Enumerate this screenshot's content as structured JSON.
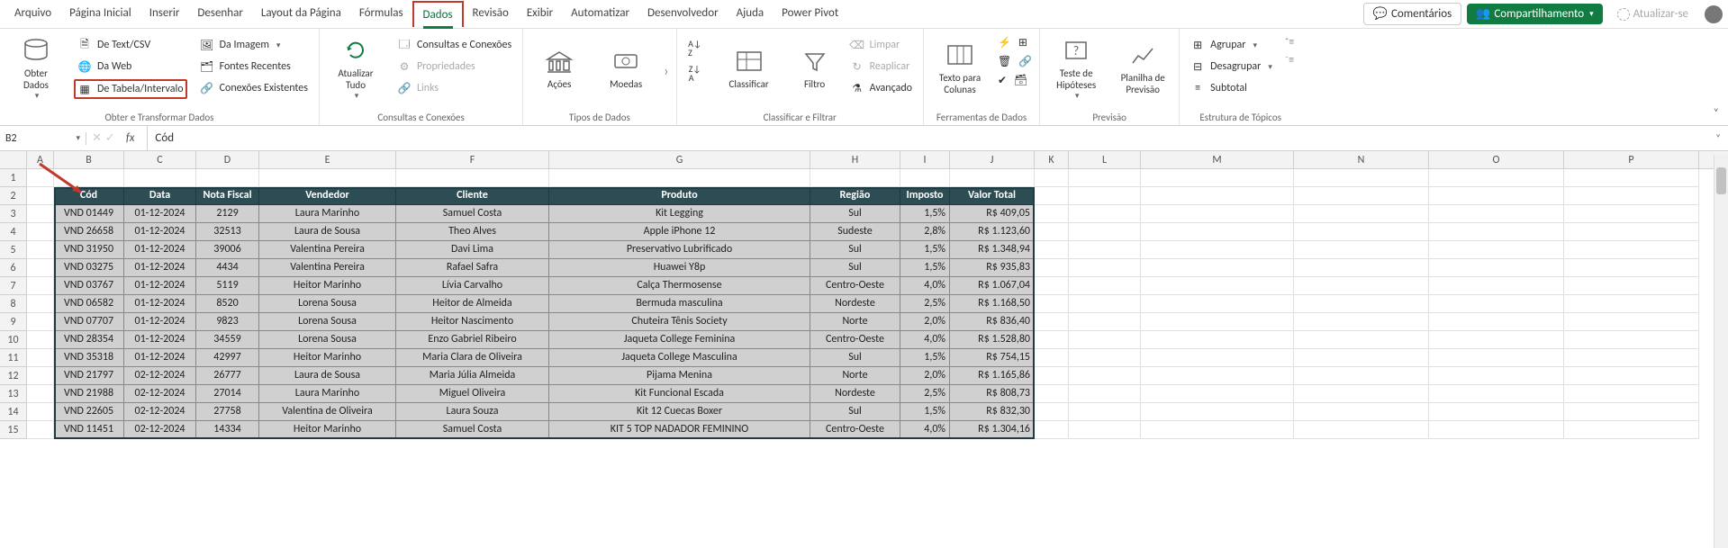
{
  "menu": {
    "items": [
      "Arquivo",
      "Página Inicial",
      "Inserir",
      "Desenhar",
      "Layout da Página",
      "Fórmulas",
      "Dados",
      "Revisão",
      "Exibir",
      "Automatizar",
      "Desenvolvedor",
      "Ajuda",
      "Power Pivot"
    ],
    "active_index": 6,
    "comments": "Comentários",
    "share": "Compartilhamento",
    "update": "Atualizar-se"
  },
  "ribbon": {
    "getdata": {
      "big": "Obter\nDados",
      "items": [
        "De Text/CSV",
        "Da Web",
        "De Tabela/Intervalo",
        "Da Imagem",
        "Fontes Recentes",
        "Conexões Existentes"
      ],
      "group": "Obter e Transformar Dados"
    },
    "queries": {
      "big": "Atualizar\nTudo",
      "items": [
        "Consultas e Conexões",
        "Propriedades",
        "Links"
      ],
      "group": "Consultas e Conexões"
    },
    "types": {
      "items": [
        "Ações",
        "Moedas"
      ],
      "group": "Tipos de Dados"
    },
    "sort": {
      "label": "Classificar",
      "group": "Classificar e Filtrar",
      "filter": "Filtro",
      "clear": "Limpar",
      "reapply": "Reaplicar",
      "advanced": "Avançado"
    },
    "tools": {
      "items": [
        "Texto para\nColunas"
      ],
      "group": "Ferramentas de Dados"
    },
    "forecast": {
      "items": [
        "Teste de\nHipóteses",
        "Planilha de\nPrevisão"
      ],
      "group": "Previsão"
    },
    "outline": {
      "items": [
        "Agrupar",
        "Desagrupar",
        "Subtotal"
      ],
      "group": "Estrutura de Tópicos"
    }
  },
  "formula": {
    "namebox": "B2",
    "fx": "fx",
    "value": "Cód"
  },
  "columns": {
    "letters": [
      "A",
      "B",
      "C",
      "D",
      "E",
      "F",
      "G",
      "H",
      "I",
      "J",
      "K",
      "L",
      "M",
      "N",
      "O",
      "P"
    ]
  },
  "headers": [
    "Cód",
    "Data",
    "Nota Fiscal",
    "Vendedor",
    "Cliente",
    "Produto",
    "Região",
    "Imposto",
    "Valor Total"
  ],
  "rows": [
    [
      "VND 01449",
      "01-12-2024",
      "2129",
      "Laura Marinho",
      "Samuel Costa",
      "Kit Legging",
      "Sul",
      "1,5%",
      "R$     409,05"
    ],
    [
      "VND 26658",
      "01-12-2024",
      "32513",
      "Laura de Sousa",
      "Theo Alves",
      "Apple iPhone 12",
      "Sudeste",
      "2,8%",
      "R$  1.123,60"
    ],
    [
      "VND 31950",
      "01-12-2024",
      "39006",
      "Valentina Pereira",
      "Davi Lima",
      "Preservativo Lubrificado",
      "Sul",
      "1,5%",
      "R$  1.348,94"
    ],
    [
      "VND 03275",
      "01-12-2024",
      "4434",
      "Valentina Pereira",
      "Rafael Safra",
      "Huawei Y8p",
      "Sul",
      "1,5%",
      "R$     935,83"
    ],
    [
      "VND 03767",
      "01-12-2024",
      "5119",
      "Heitor Marinho",
      "Lívia Carvalho",
      "Calça Thermosense",
      "Centro-Oeste",
      "4,0%",
      "R$  1.067,04"
    ],
    [
      "VND 06582",
      "01-12-2024",
      "8520",
      "Lorena Sousa",
      "Heitor de Almeida",
      "Bermuda masculina",
      "Nordeste",
      "2,5%",
      "R$  1.168,50"
    ],
    [
      "VND 07707",
      "01-12-2024",
      "9823",
      "Lorena Sousa",
      "Heitor Nascimento",
      "Chuteira Tênis Society",
      "Norte",
      "2,0%",
      "R$     836,40"
    ],
    [
      "VND 28354",
      "01-12-2024",
      "34559",
      "Lorena Sousa",
      "Enzo Gabriel Ribeiro",
      "Jaqueta College Feminina",
      "Centro-Oeste",
      "4,0%",
      "R$  1.528,80"
    ],
    [
      "VND 35318",
      "01-12-2024",
      "42997",
      "Heitor Marinho",
      "Maria Clara de Oliveira",
      "Jaqueta College Masculina",
      "Sul",
      "1,5%",
      "R$     754,15"
    ],
    [
      "VND 21797",
      "02-12-2024",
      "26777",
      "Laura de Sousa",
      "Maria Júlia Almeida",
      "Pijama Menina",
      "Norte",
      "2,0%",
      "R$  1.165,86"
    ],
    [
      "VND 21988",
      "02-12-2024",
      "27014",
      "Laura Marinho",
      "Miguel Oliveira",
      "Kit Funcional Escada",
      "Nordeste",
      "2,5%",
      "R$     808,73"
    ],
    [
      "VND 22605",
      "02-12-2024",
      "27758",
      "Valentina de Oliveira",
      "Laura Souza",
      "Kit 12 Cuecas Boxer",
      "Sul",
      "1,5%",
      "R$     832,30"
    ],
    [
      "VND 11451",
      "02-12-2024",
      "14334",
      "Heitor Marinho",
      "Samuel Costa",
      "KIT 5 TOP NADADOR FEMININO",
      "Centro-Oeste",
      "4,0%",
      "R$  1.304,16"
    ]
  ],
  "chart_data": {
    "type": "table",
    "columns": [
      "Cód",
      "Data",
      "Nota Fiscal",
      "Vendedor",
      "Cliente",
      "Produto",
      "Região",
      "Imposto",
      "Valor Total"
    ],
    "data": [
      {
        "Cód": "VND 01449",
        "Data": "01-12-2024",
        "Nota Fiscal": 2129,
        "Vendedor": "Laura Marinho",
        "Cliente": "Samuel Costa",
        "Produto": "Kit Legging",
        "Região": "Sul",
        "Imposto": 0.015,
        "Valor Total": 409.05
      },
      {
        "Cód": "VND 26658",
        "Data": "01-12-2024",
        "Nota Fiscal": 32513,
        "Vendedor": "Laura de Sousa",
        "Cliente": "Theo Alves",
        "Produto": "Apple iPhone 12",
        "Região": "Sudeste",
        "Imposto": 0.028,
        "Valor Total": 1123.6
      },
      {
        "Cód": "VND 31950",
        "Data": "01-12-2024",
        "Nota Fiscal": 39006,
        "Vendedor": "Valentina Pereira",
        "Cliente": "Davi Lima",
        "Produto": "Preservativo Lubrificado",
        "Região": "Sul",
        "Imposto": 0.015,
        "Valor Total": 1348.94
      },
      {
        "Cód": "VND 03275",
        "Data": "01-12-2024",
        "Nota Fiscal": 4434,
        "Vendedor": "Valentina Pereira",
        "Cliente": "Rafael Safra",
        "Produto": "Huawei Y8p",
        "Região": "Sul",
        "Imposto": 0.015,
        "Valor Total": 935.83
      },
      {
        "Cód": "VND 03767",
        "Data": "01-12-2024",
        "Nota Fiscal": 5119,
        "Vendedor": "Heitor Marinho",
        "Cliente": "Lívia Carvalho",
        "Produto": "Calça Thermosense",
        "Região": "Centro-Oeste",
        "Imposto": 0.04,
        "Valor Total": 1067.04
      },
      {
        "Cód": "VND 06582",
        "Data": "01-12-2024",
        "Nota Fiscal": 8520,
        "Vendedor": "Lorena Sousa",
        "Cliente": "Heitor de Almeida",
        "Produto": "Bermuda masculina",
        "Região": "Nordeste",
        "Imposto": 0.025,
        "Valor Total": 1168.5
      },
      {
        "Cód": "VND 07707",
        "Data": "01-12-2024",
        "Nota Fiscal": 9823,
        "Vendedor": "Lorena Sousa",
        "Cliente": "Heitor Nascimento",
        "Produto": "Chuteira Tênis Society",
        "Região": "Norte",
        "Imposto": 0.02,
        "Valor Total": 836.4
      },
      {
        "Cód": "VND 28354",
        "Data": "01-12-2024",
        "Nota Fiscal": 34559,
        "Vendedor": "Lorena Sousa",
        "Cliente": "Enzo Gabriel Ribeiro",
        "Produto": "Jaqueta College Feminina",
        "Região": "Centro-Oeste",
        "Imposto": 0.04,
        "Valor Total": 1528.8
      },
      {
        "Cód": "VND 35318",
        "Data": "01-12-2024",
        "Nota Fiscal": 42997,
        "Vendedor": "Heitor Marinho",
        "Cliente": "Maria Clara de Oliveira",
        "Produto": "Jaqueta College Masculina",
        "Região": "Sul",
        "Imposto": 0.015,
        "Valor Total": 754.15
      },
      {
        "Cód": "VND 21797",
        "Data": "02-12-2024",
        "Nota Fiscal": 26777,
        "Vendedor": "Laura de Sousa",
        "Cliente": "Maria Júlia Almeida",
        "Produto": "Pijama Menina",
        "Região": "Norte",
        "Imposto": 0.02,
        "Valor Total": 1165.86
      },
      {
        "Cód": "VND 21988",
        "Data": "02-12-2024",
        "Nota Fiscal": 27014,
        "Vendedor": "Laura Marinho",
        "Cliente": "Miguel Oliveira",
        "Produto": "Kit Funcional Escada",
        "Região": "Nordeste",
        "Imposto": 0.025,
        "Valor Total": 808.73
      },
      {
        "Cód": "VND 22605",
        "Data": "02-12-2024",
        "Nota Fiscal": 27758,
        "Vendedor": "Valentina de Oliveira",
        "Cliente": "Laura Souza",
        "Produto": "Kit 12 Cuecas Boxer",
        "Região": "Sul",
        "Imposto": 0.015,
        "Valor Total": 832.3
      },
      {
        "Cód": "VND 11451",
        "Data": "02-12-2024",
        "Nota Fiscal": 14334,
        "Vendedor": "Heitor Marinho",
        "Cliente": "Samuel Costa",
        "Produto": "KIT 5 TOP NADADOR FEMININO",
        "Região": "Centro-Oeste",
        "Imposto": 0.04,
        "Valor Total": 1304.16
      }
    ]
  }
}
